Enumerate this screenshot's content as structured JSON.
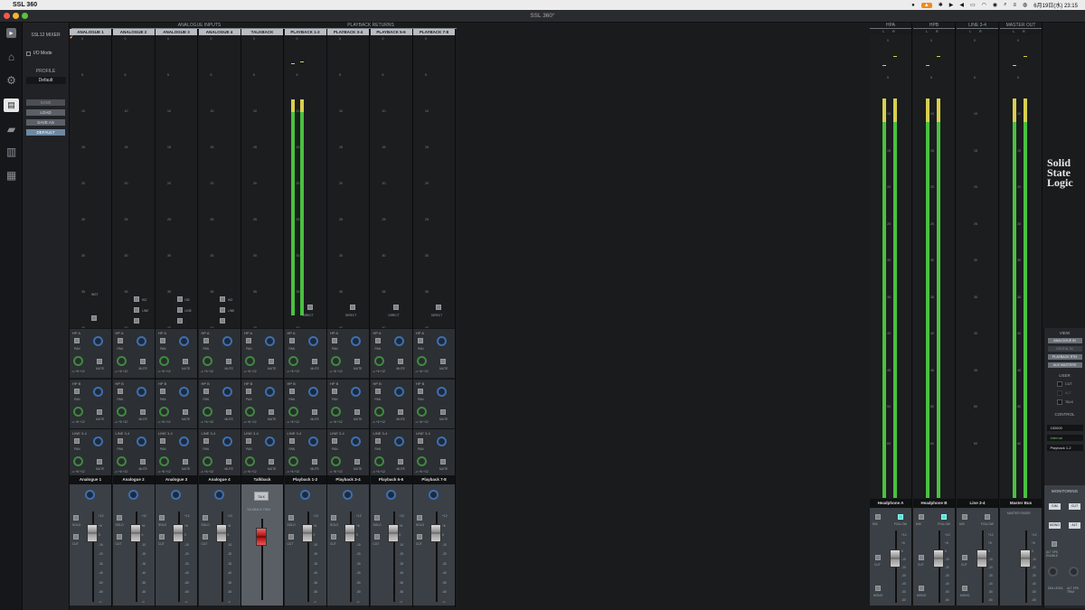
{
  "menubar": {
    "app_name": "SSL 360",
    "date_time": "6月19日(水) 23:15"
  },
  "window": {
    "title": "SSL 360°"
  },
  "profile": {
    "mixer_title": "SSL12 MIXER",
    "io_mode_label": "I/O Mode",
    "profile_label": "PROFILE",
    "profile_value": "Default",
    "buttons": [
      "SAVE",
      "LOAD",
      "SAVE AS",
      "DEFAULT"
    ]
  },
  "groups": {
    "analogue_inputs": "ANALOGUE INPUTS",
    "playback_returns": "PLAYBACK RETURNS"
  },
  "scale_labels": [
    "0",
    "5",
    "10",
    "15",
    "20",
    "25",
    "30",
    "35",
    "40",
    "45",
    "50",
    "60"
  ],
  "channels": [
    {
      "header": "ANALOGUE 1",
      "name": "Analogue 1"
    },
    {
      "header": "ANALOGUE 2",
      "name": "Analogue 2"
    },
    {
      "header": "ANALOGUE 3",
      "name": "Analogue 3"
    },
    {
      "header": "ANALOGUE 4",
      "name": "Analogue 4"
    },
    {
      "header": "TALKBACK",
      "name": "Talkback"
    },
    {
      "header": "PLAYBACK 1-2",
      "name": "Playback 1-2"
    },
    {
      "header": "PLAYBACK 3-4",
      "name": "Playback 3-4"
    },
    {
      "header": "PLAYBACK 5-6",
      "name": "Playback 5-6"
    },
    {
      "header": "PLAYBACK 7-8",
      "name": "Playback 7-8"
    }
  ],
  "input_options": {
    "inst": "INST",
    "hiz": "HIZ",
    "line": "LINE",
    "direct": "DIRECT"
  },
  "send_labels": [
    "HP A",
    "HP B",
    "LINE 3-4"
  ],
  "send_small": {
    "pan": "PAN",
    "mute": "MUTE",
    "range": "-∞  +6  +12"
  },
  "fader_small": {
    "solo": "SOLO",
    "cut": "CUT",
    "talk": "TALK",
    "talkback_trim": "TALKBACK TRIM"
  },
  "fader_scale": [
    "+12",
    "+6",
    "0",
    "-10",
    "-20",
    "-30",
    "-40",
    "-50",
    "-60",
    "-∞"
  ],
  "outputs": [
    {
      "header": "HPA",
      "name": "Headphone A"
    },
    {
      "header": "HPB",
      "name": "Headphone B"
    },
    {
      "header": "LINE 3-4",
      "name": "Line 3-4"
    },
    {
      "header": "MASTER OUT",
      "name": "Master Bus"
    }
  ],
  "out_small": {
    "lr": "L R",
    "mix": "MIX",
    "follow": "FOLLOW",
    "cut": "CUT",
    "mono": "MONO",
    "master_fader": "MASTER FADER"
  },
  "brand": [
    "Solid",
    "State",
    "Logic"
  ],
  "view_panel": {
    "title": "VIEW",
    "buttons": [
      "ANALOGUE IN",
      "DIGITAL IN",
      "PLAYBACK RTN",
      "AUX MASTERS"
    ],
    "user_title": "USER",
    "user_buttons": [
      "CUT",
      "ALT",
      "TALK"
    ],
    "control_title": "CONTROL",
    "sample_rate": "192000",
    "clock": "Internal",
    "monitor_source": "Playback 1-2"
  },
  "monitoring": {
    "title": "MONITORING",
    "buttons": [
      "DIM",
      "CUT",
      "MONO",
      "ALT"
    ],
    "alt_spk_enable": "ALT SPK ENABLE",
    "dim_level": "DIM LEVEL",
    "alt_spk_trim": "ALT SPK TRIM"
  },
  "colors": {
    "meter_green": "#49c13f",
    "meter_yellow": "#d8cf4c",
    "knob_green": "#3e8a3e",
    "pan_blue": "#3c6fb0",
    "fader_red": "#b01818",
    "accent_orange": "#f28a1c"
  }
}
